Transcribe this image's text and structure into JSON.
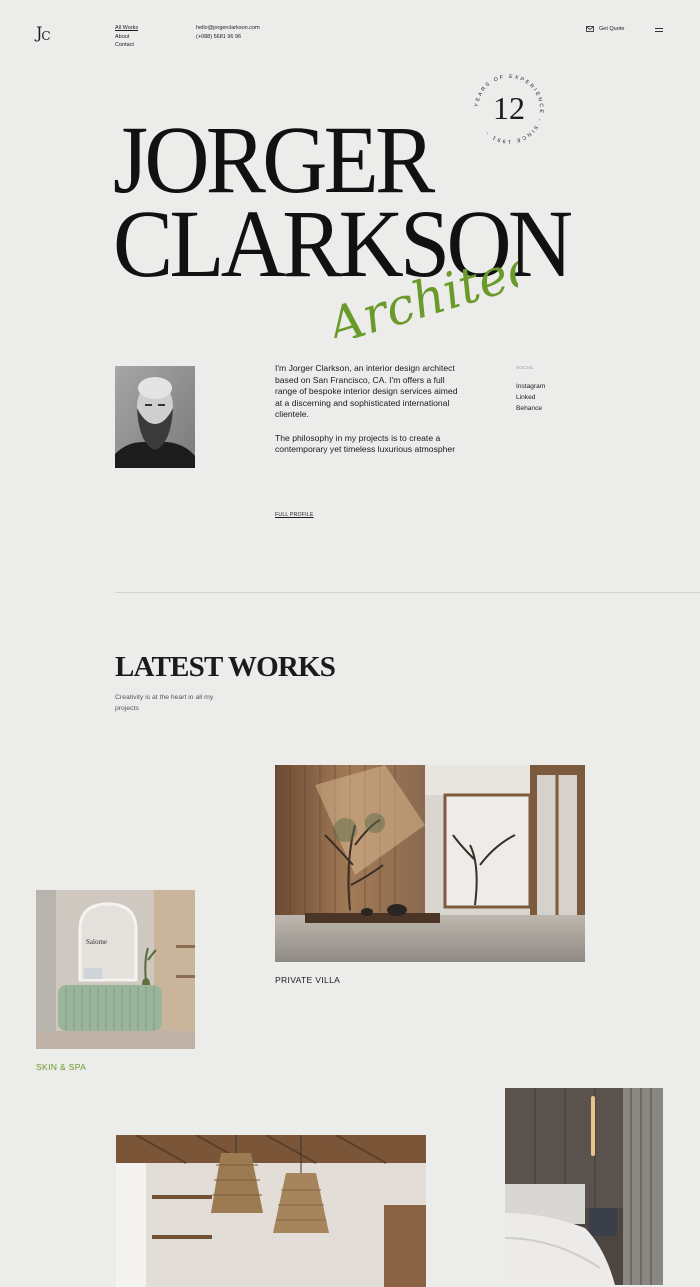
{
  "header": {
    "logo_left": "J",
    "logo_right": "C",
    "nav": [
      {
        "label": "All Works",
        "active": true
      },
      {
        "label": "About",
        "active": false
      },
      {
        "label": "Contact",
        "active": false
      }
    ],
    "email": "hello@jorgerclarkson.com",
    "phone": "(+088) 5681 96 96",
    "get_quote": "Get Quote"
  },
  "badge": {
    "number": "12",
    "ring_text": "YEARS OF EXPERIENCE - SINCE 1991 -"
  },
  "hero": {
    "first_name": "JORGER",
    "last_name": "CLARKSON",
    "script_title": "Architect",
    "script_color": "#6a9a2a"
  },
  "profile": {
    "bio_1": "I'm Jorger Clarkson, an interior design architect based on San Francisco, CA. I'm offers a full range of bespoke interior design services aimed at a discerning and sophisticated international clientele.",
    "bio_2": "The philosophy in my projects is to create a contemporary yet timeless luxurious atmospher",
    "full_profile": "FULL PROFILE",
    "social_heading": "SOCIAL",
    "social_links": [
      "Instagram",
      "Linked",
      "Behance"
    ]
  },
  "works": {
    "title": "LATEST WORKS",
    "subtitle": "Creativity is at the heart in all my projects",
    "items": [
      {
        "caption": "PRIVATE VILLA"
      },
      {
        "caption": "SKIN & SPA",
        "sign_text": "Salome"
      },
      {
        "caption": ""
      },
      {
        "caption": ""
      }
    ]
  },
  "colors": {
    "background": "#ececeb",
    "accent_green": "#6a9a2a",
    "text": "#1b1b1b"
  }
}
